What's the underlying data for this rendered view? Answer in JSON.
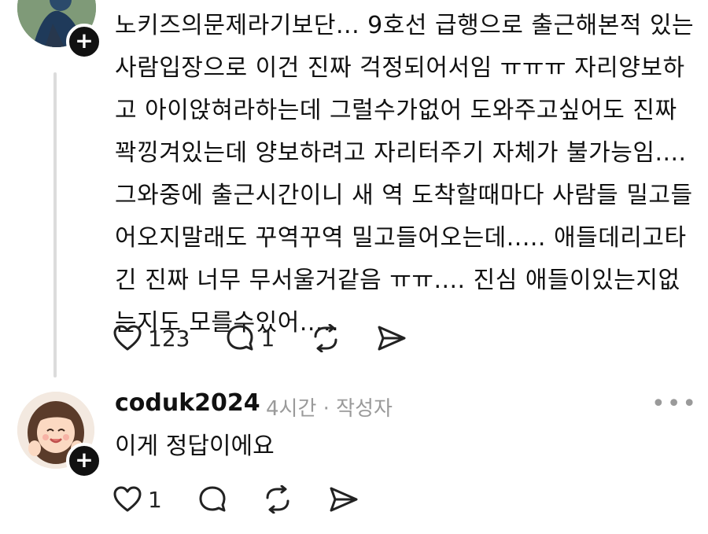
{
  "post": {
    "text": "노키즈의문제라기보단... 9호선 급행으로 출근해본적 있는 사람입장으로 이건 진짜 걱정되어서임 ㅠㅠㅠ 자리양보하고 아이앉혀라하는데 그럴수가없어 도와주고싶어도 진짜 꽉낑겨있는데 양보하려고 자리터주기 자체가 불가능임.... 그와중에 출근시간이니 새 역 도착할때마다 사람들 밀고들어오지말래도 꾸역꾸역 밀고들어오는데..... 애들데리고타긴 진짜 너무 무서울거같음 ㅠㅠ.... 진심 애들이있는지없는지도 모를수있어.....",
    "likes": "123",
    "replies": "1",
    "follow_symbol": "+"
  },
  "reply": {
    "username": "coduk2024",
    "meta": "4시간 · 작성자",
    "text": "이게 정답이에요",
    "likes": "1",
    "follow_symbol": "+",
    "more_symbol": "•••"
  },
  "colors": {
    "text": "#111111",
    "muted": "#9a9a9a",
    "thread_line": "#dcdcdc",
    "badge": "#111111"
  }
}
